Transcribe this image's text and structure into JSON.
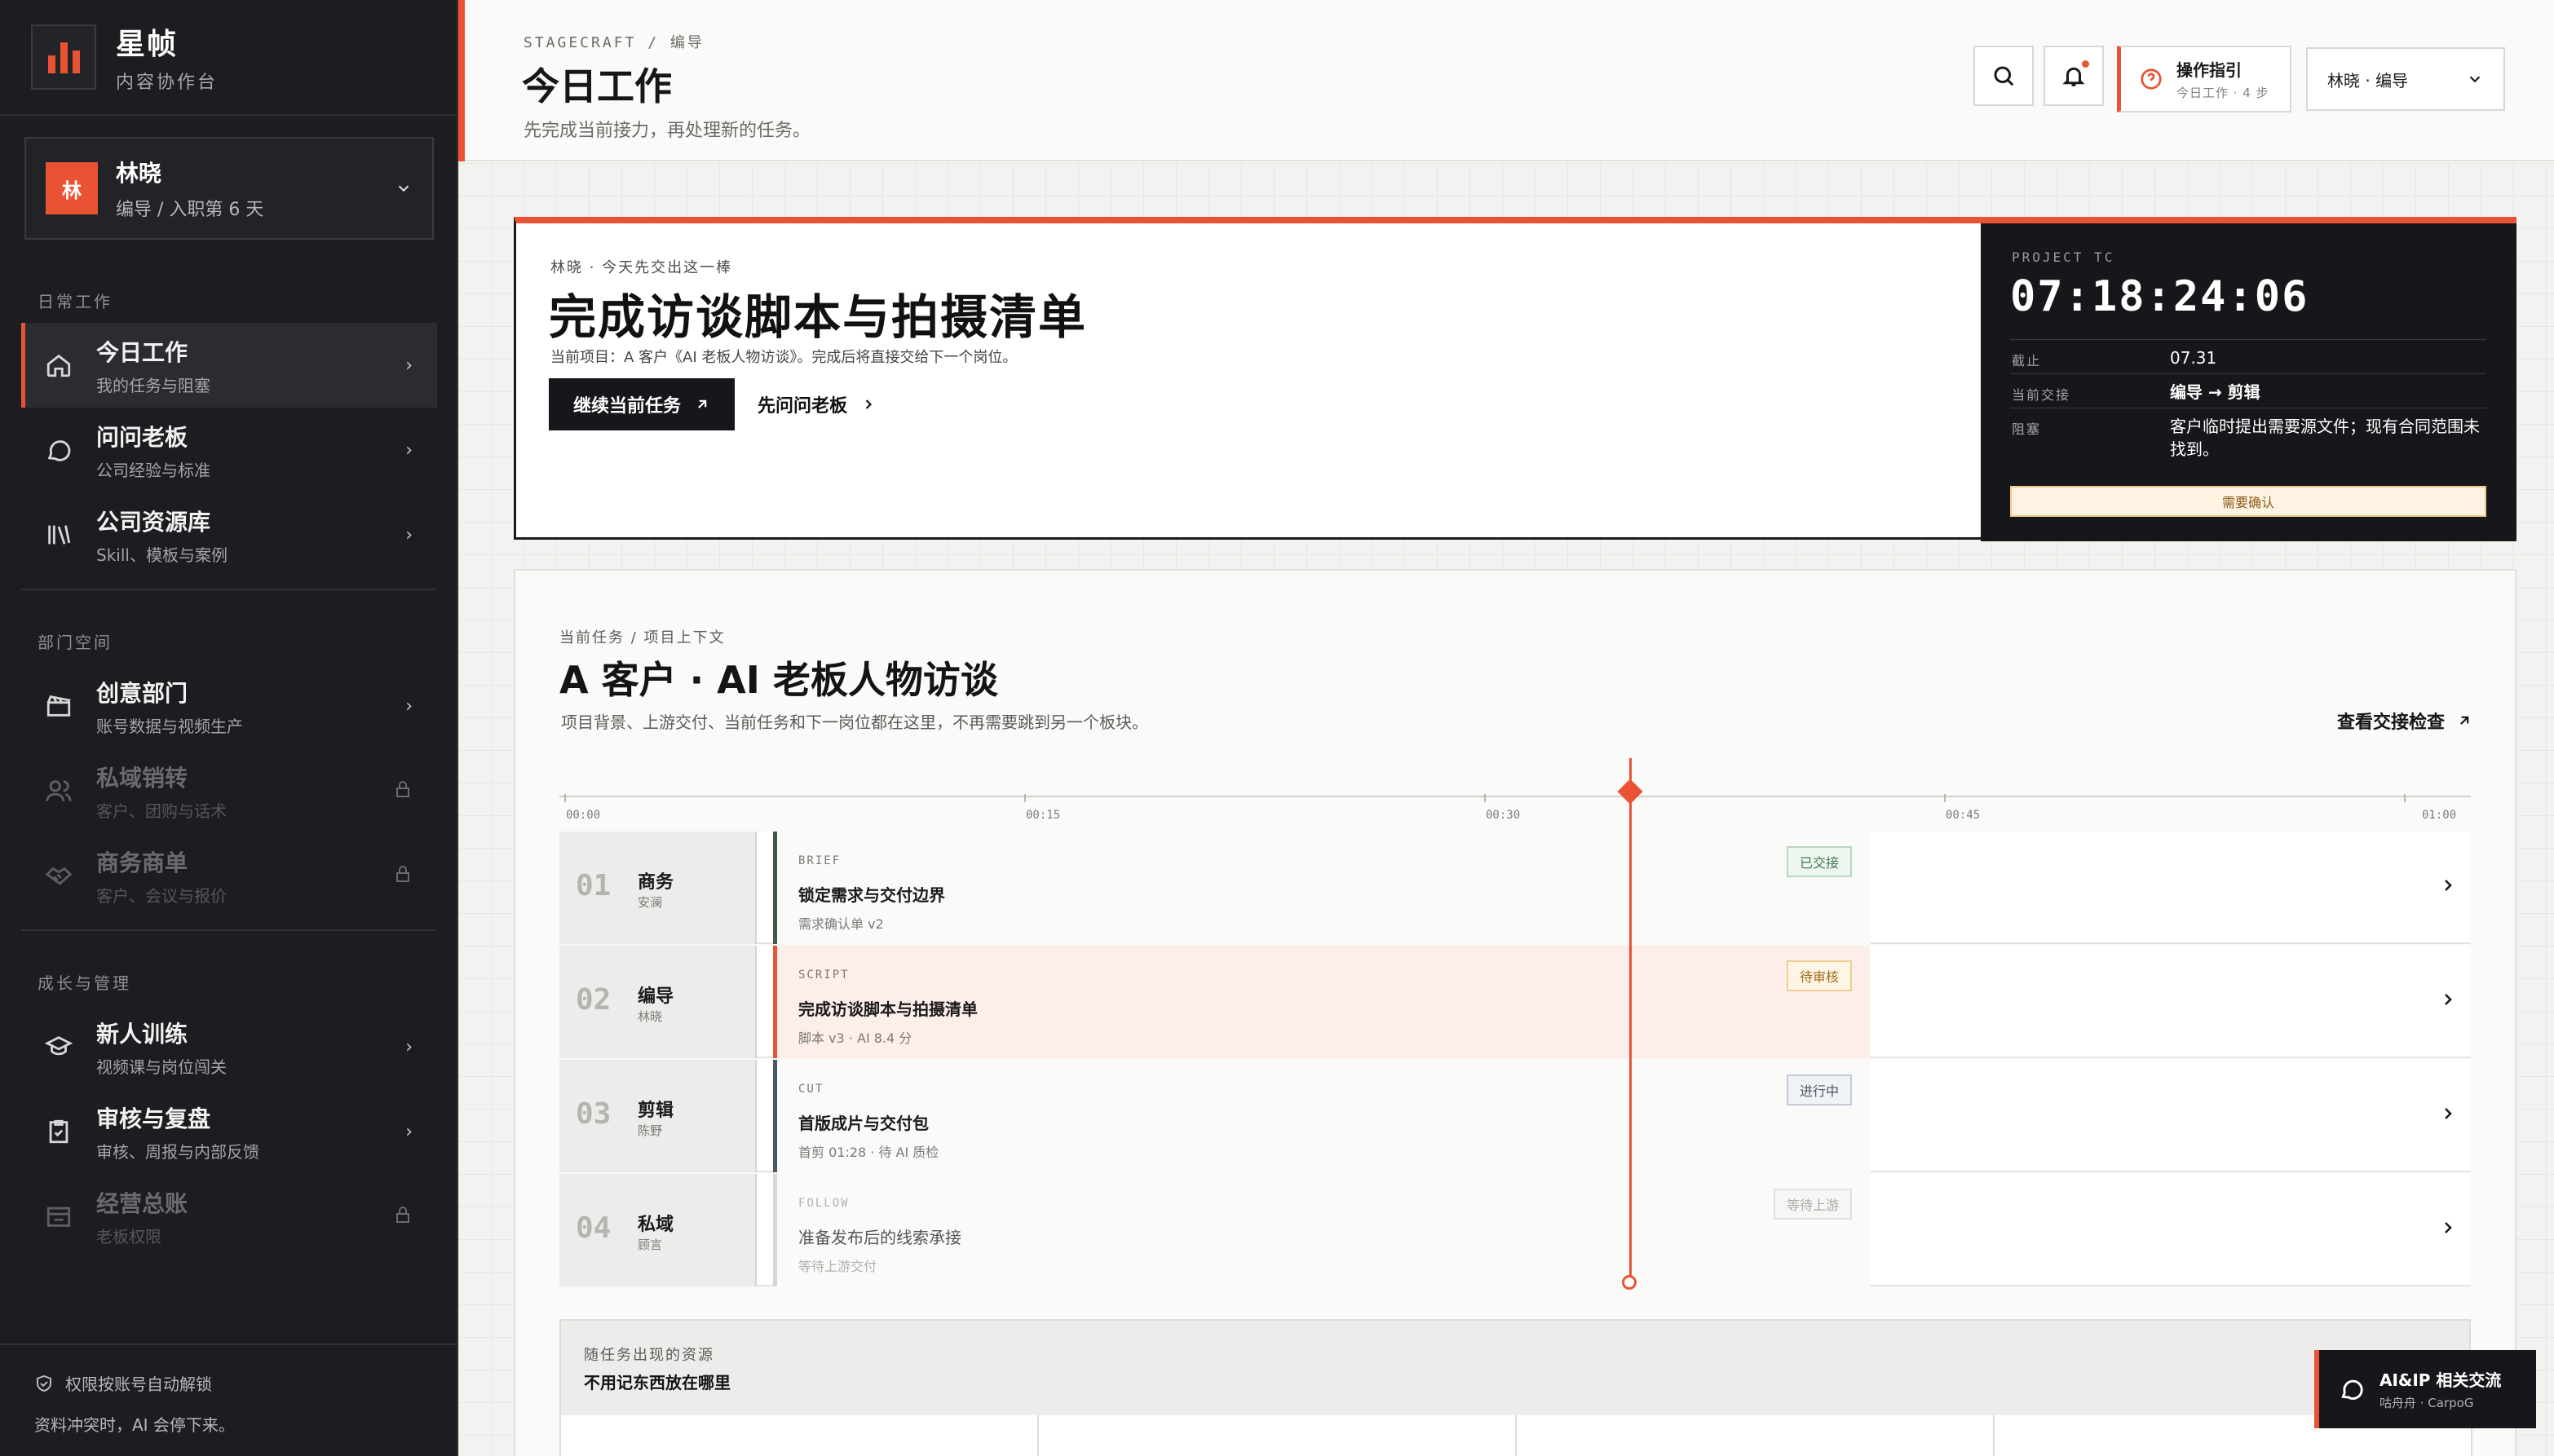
{
  "brand": {
    "title": "星帧",
    "subtitle": "内容协作台"
  },
  "user": {
    "avatar": "林",
    "name": "林晓",
    "role": "编导 / 入职第 6 天"
  },
  "sidebar": {
    "sections": [
      {
        "label": "日常工作"
      },
      {
        "label": "部门空间"
      },
      {
        "label": "成长与管理"
      }
    ],
    "items": [
      {
        "icon": "home-icon",
        "title": "今日工作",
        "sub": "我的任务与阻塞",
        "active": true,
        "locked": false
      },
      {
        "icon": "chat-icon",
        "title": "问问老板",
        "sub": "公司经验与标准",
        "active": false,
        "locked": false
      },
      {
        "icon": "library-icon",
        "title": "公司资源库",
        "sub": "Skill、模板与案例",
        "active": false,
        "locked": false
      },
      {
        "icon": "clapper-icon",
        "title": "创意部门",
        "sub": "账号数据与视频生产",
        "active": false,
        "locked": false
      },
      {
        "icon": "users-icon",
        "title": "私域销转",
        "sub": "客户、团购与话术",
        "active": false,
        "locked": true
      },
      {
        "icon": "handshake-icon",
        "title": "商务商单",
        "sub": "客户、会议与报价",
        "active": false,
        "locked": true
      },
      {
        "icon": "graduation-icon",
        "title": "新人训练",
        "sub": "视频课与岗位闯关",
        "active": false,
        "locked": false
      },
      {
        "icon": "clipboard-icon",
        "title": "审核与复盘",
        "sub": "审核、周报与内部反馈",
        "active": false,
        "locked": false
      },
      {
        "icon": "ledger-icon",
        "title": "经营总账",
        "sub": "老板权限",
        "active": false,
        "locked": true
      }
    ],
    "footer_line1": "权限按账号自动解锁",
    "footer_line2": "资料冲突时，AI 会停下来。"
  },
  "header": {
    "breadcrumb": "STAGECRAFT  /  编导",
    "title": "今日工作",
    "subtitle": "先完成当前接力，再处理新的任务。",
    "guide_title": "操作指引",
    "guide_sub": "今日工作 · 4 步",
    "role_select": "林晓 · 编导"
  },
  "hero": {
    "kicker": "林晓  ·  今天先交出这一棒",
    "title": "完成访谈脚本与拍摄清单",
    "desc": "当前项目：A 客户《AI 老板人物访谈》。完成后将直接交给下一个岗位。",
    "primary_btn": "继续当前任务",
    "secondary_btn": "先问问老板",
    "panel": {
      "label": "PROJECT TC",
      "clock": "07:18:24:06",
      "rows": [
        {
          "key": "截止",
          "value": "07.31"
        },
        {
          "key": "当前交接",
          "value": "编导 → 剪辑"
        },
        {
          "key": "阻塞",
          "value": "客户临时提出需要源文件；现有合同范围未找到。"
        }
      ],
      "confirm": "需要确认"
    }
  },
  "context": {
    "breadcrumb": "当前任务  /  项目上下文",
    "title": "A 客户 · AI 老板人物访谈",
    "desc": "项目背景、上游交付、当前任务和下一岗位都在这里，不再需要跳到另一个板块。",
    "link": "查看交接检查",
    "ticks": [
      "00:00",
      "00:15",
      "00:30",
      "00:45",
      "01:00"
    ],
    "rows": [
      {
        "num": "01",
        "dept": "商务",
        "person": "安澜",
        "code": "BRIEF",
        "task": "锁定需求与交付边界",
        "meta": "需求确认单 v2",
        "badge": "已交接",
        "state": "done"
      },
      {
        "num": "02",
        "dept": "编导",
        "person": "林晓",
        "code": "SCRIPT",
        "task": "完成访谈脚本与拍摄清单",
        "meta": "脚本 v3 · AI 8.4 分",
        "badge": "待审核",
        "state": "current"
      },
      {
        "num": "03",
        "dept": "剪辑",
        "person": "陈野",
        "code": "CUT",
        "task": "首版成片与交付包",
        "meta": "首剪 01:28 · 待 AI 质检",
        "badge": "进行中",
        "state": "progress"
      },
      {
        "num": "04",
        "dept": "私域",
        "person": "顾言",
        "code": "FOLLOW",
        "task": "准备发布后的线索承接",
        "meta": "等待上游交付",
        "badge": "等待上游",
        "state": "waiting"
      }
    ]
  },
  "resources": {
    "label": "随任务出现的资源",
    "title": "不用记东西放在哪里"
  },
  "chat": {
    "title": "AI&IP 相关交流",
    "sub": "咕舟舟 · CarpoG"
  },
  "colors": {
    "accent": "#ea5234",
    "sidebar": "#1c1d20"
  }
}
